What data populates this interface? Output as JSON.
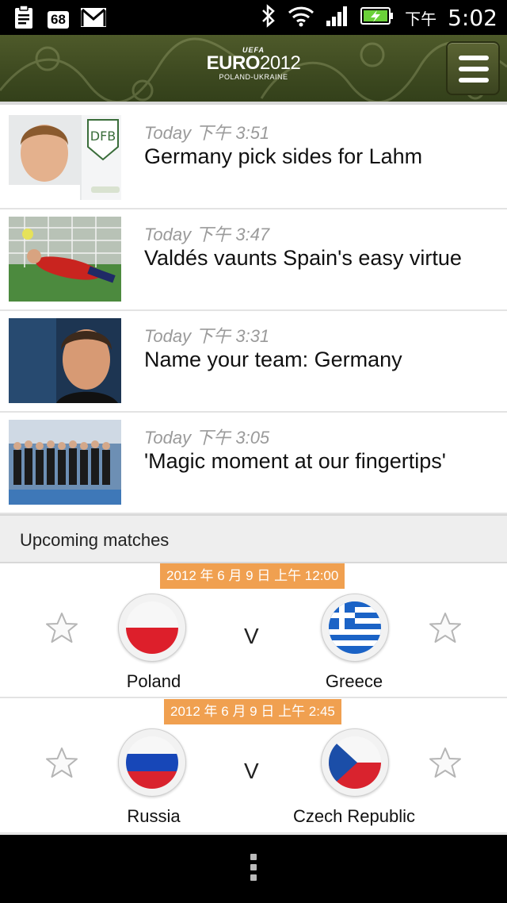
{
  "status_bar": {
    "badge": "68",
    "ampm": "下午",
    "time": "5:02"
  },
  "header": {
    "logo_top": "UEFA",
    "logo_main": "EURO",
    "logo_year": "2012",
    "logo_sub": "POLAND-UKRAINE"
  },
  "news": [
    {
      "time": "Today 下午 3:51",
      "title": "Germany pick sides for Lahm"
    },
    {
      "time": "Today 下午 3:47",
      "title": "Valdés vaunts Spain's easy virtue"
    },
    {
      "time": "Today 下午 3:31",
      "title": "Name your team: Germany"
    },
    {
      "time": "Today 下午 3:05",
      "title": "'Magic moment at our fingertips'"
    }
  ],
  "upcoming": {
    "heading": "Upcoming matches",
    "matches": [
      {
        "date": "2012 年 6 月 9 日 上午 12:00",
        "home": "Poland",
        "away": "Greece",
        "vs": "V"
      },
      {
        "date": "2012 年 6 月 9 日 上午 2:45",
        "home": "Russia",
        "away": "Czech Republic",
        "vs": "V"
      }
    ]
  },
  "colors": {
    "header_green": "#3d4920",
    "date_badge": "#f0a050",
    "section_bg": "#eeeeee"
  }
}
